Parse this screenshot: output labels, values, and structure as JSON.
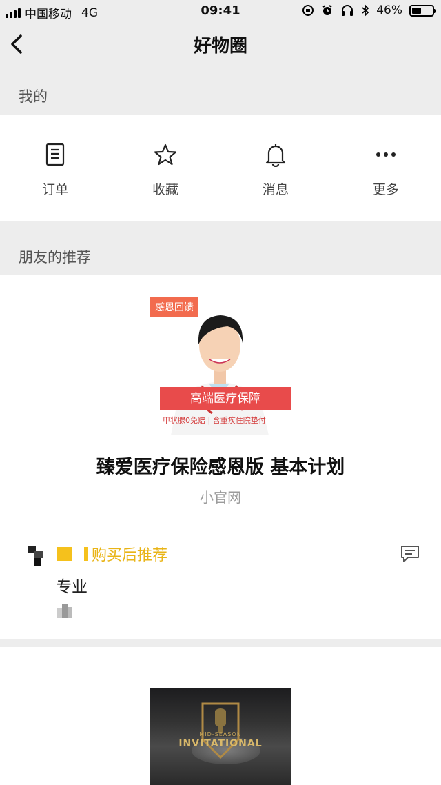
{
  "status_bar": {
    "carrier": "中国移动",
    "network": "4G",
    "time": "09:41",
    "battery_percent": "46%",
    "battery_level": 0.46
  },
  "navbar": {
    "title": "好物圈"
  },
  "mine_section": {
    "label": "我的",
    "items": [
      {
        "label": "订单",
        "icon": "order-list-icon"
      },
      {
        "label": "收藏",
        "icon": "star-icon"
      },
      {
        "label": "消息",
        "icon": "bell-icon"
      },
      {
        "label": "更多",
        "icon": "more-dots-icon"
      }
    ]
  },
  "friends_section": {
    "label": "朋友的推荐"
  },
  "product": {
    "image_tag": "感恩回馈",
    "image_banner": "高端医疗保障",
    "image_subtext": "甲状腺0免赔 | 含重疾住院垫付",
    "title": "臻爱医疗保险感恩版 基本计划",
    "source": "小官网"
  },
  "recommendation": {
    "label": "购买后推荐",
    "text": "专业"
  },
  "feed_item_2": {
    "image_top_text": "MID-SEASON",
    "image_main_text": "INVITATIONAL"
  },
  "colors": {
    "background": "#ededed",
    "accent_yellow": "#e9b416",
    "banner_red": "#e84b4b",
    "tag_orange": "#f26b4e"
  }
}
